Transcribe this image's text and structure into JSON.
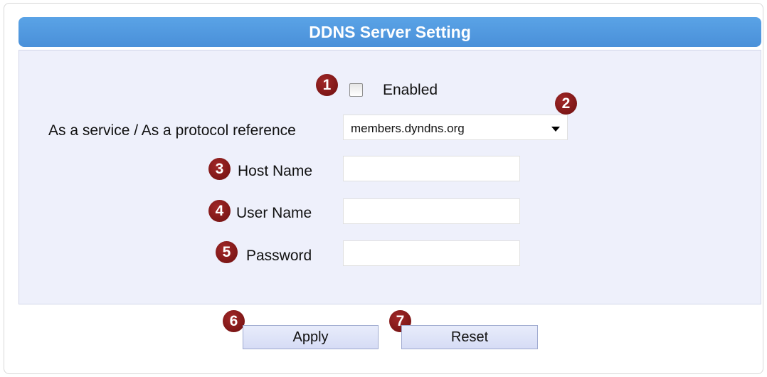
{
  "header": {
    "title": "DDNS Server Setting"
  },
  "form": {
    "enabled_label": "Enabled",
    "enabled_checked": false,
    "service_label": "As a service / As a protocol reference",
    "service_value": "members.dyndns.org",
    "host_label": "Host Name",
    "host_value": "",
    "user_label": "User Name",
    "user_value": "",
    "password_label": "Password",
    "password_value": ""
  },
  "buttons": {
    "apply": "Apply",
    "reset": "Reset"
  },
  "badges": [
    "1",
    "2",
    "3",
    "4",
    "5",
    "6",
    "7"
  ],
  "colors": {
    "header": "#4a90d9",
    "panel": "#eef0fb",
    "badge": "#7a1414"
  }
}
